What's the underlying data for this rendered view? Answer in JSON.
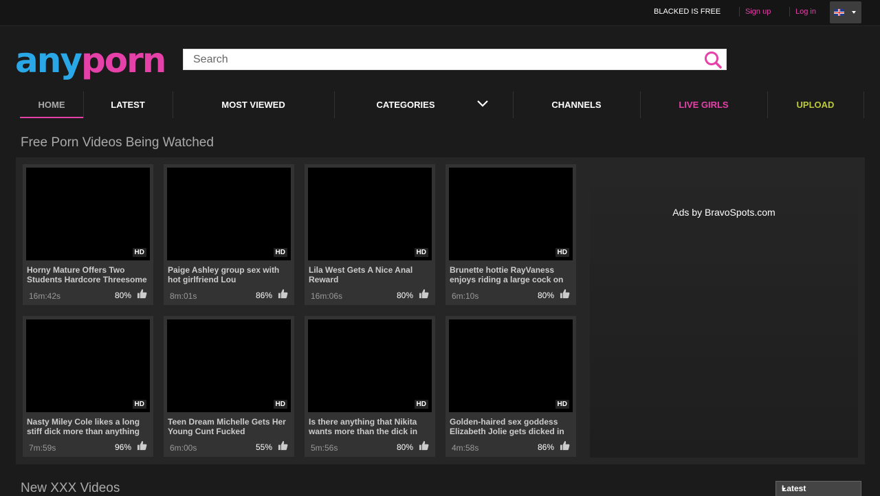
{
  "topbar": {
    "promo": "BLACKED IS FREE",
    "signup": "Sign up",
    "login": "Log in",
    "language_icon": "uk-flag-icon"
  },
  "logo": {
    "part1": "any",
    "part2": "porn"
  },
  "search": {
    "placeholder": "Search"
  },
  "nav": {
    "home": "HOME",
    "latest": "LATEST",
    "most_viewed": "MOST VIEWED",
    "categories": "CATEGORIES",
    "channels": "CHANNELS",
    "live_girls": "LIVE GIRLS",
    "upload": "UPLOAD"
  },
  "section1": {
    "title": "Free Porn Videos Being Watched"
  },
  "videos": [
    {
      "title": "Horny Mature Offers Two Students Hardcore Threesome",
      "duration": "16m:42s",
      "rating": "80%",
      "badge": "HD"
    },
    {
      "title": "Paige Ashley group sex with hot girlfriend Lou",
      "duration": "8m:01s",
      "rating": "86%",
      "badge": "HD"
    },
    {
      "title": "Lila West Gets A Nice Anal Reward",
      "duration": "16m:06s",
      "rating": "80%",
      "badge": "HD"
    },
    {
      "title": "Brunette hottie RayVaness enjoys riding a large cock on",
      "duration": "6m:10s",
      "rating": "80%",
      "badge": "HD"
    },
    {
      "title": "Nasty Miley Cole likes a long stiff dick more than anything",
      "duration": "7m:59s",
      "rating": "96%",
      "badge": "HD"
    },
    {
      "title": "Teen Dream Michelle Gets Her Young Cunt Fucked",
      "duration": "6m:00s",
      "rating": "55%",
      "badge": "HD"
    },
    {
      "title": "Is there anything that Nikita wants more than the dick in",
      "duration": "5m:56s",
      "rating": "80%",
      "badge": "HD"
    },
    {
      "title": "Golden-haired sex goddess Elizabeth Jolie gets dicked in",
      "duration": "4m:58s",
      "rating": "86%",
      "badge": "HD"
    }
  ],
  "ad": {
    "text": "Ads by BravoSpots.com"
  },
  "section2": {
    "title": "New XXX Videos",
    "sort_selected": "Latest"
  },
  "colors": {
    "brand_blue": "#2aa7e6",
    "brand_pink": "#e541a9",
    "upload_lime": "#bcca3a"
  }
}
